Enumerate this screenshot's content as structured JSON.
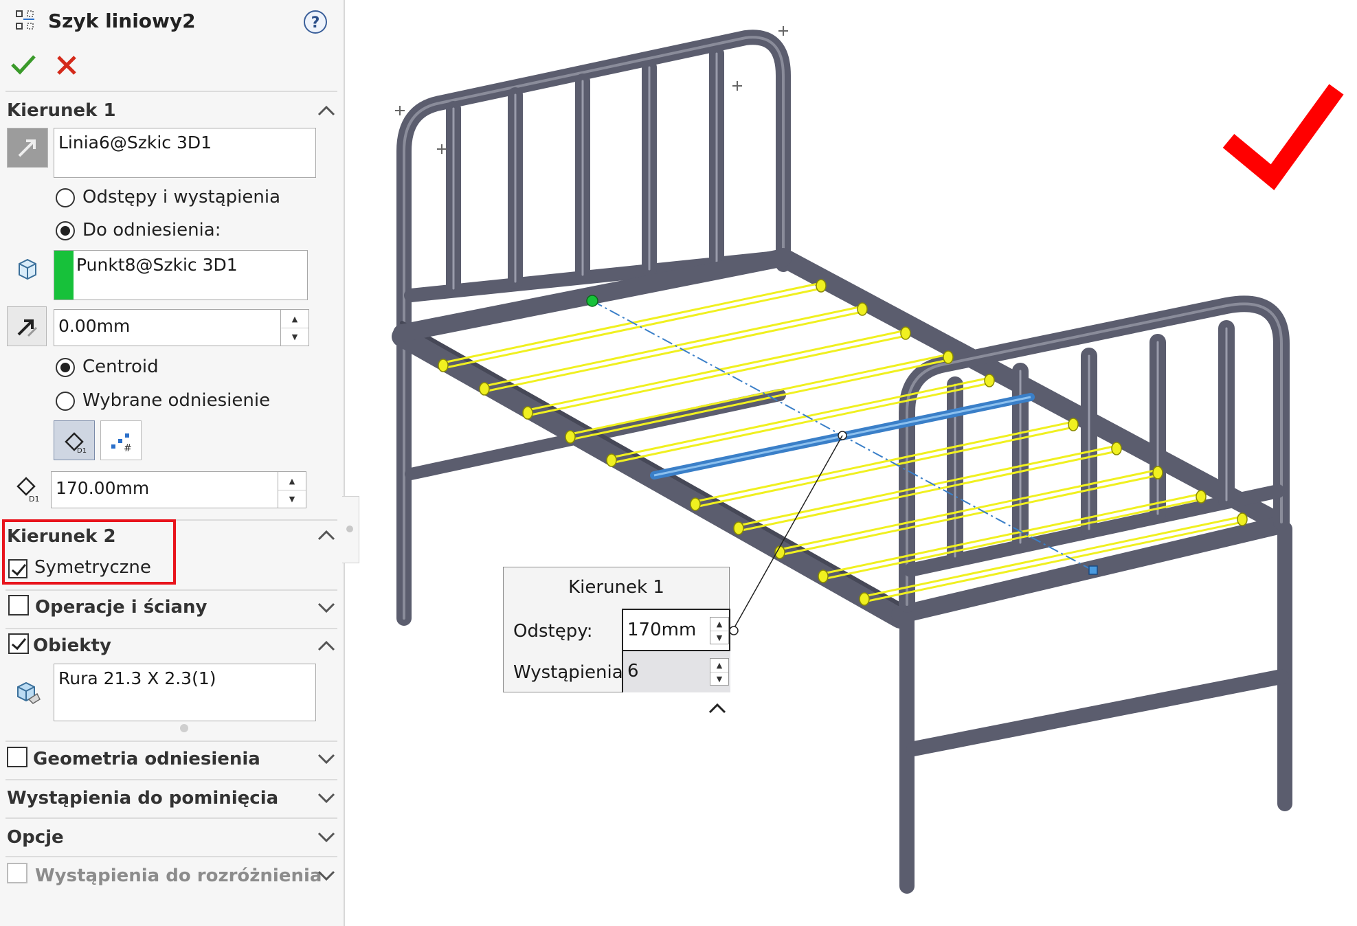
{
  "panel": {
    "title": "Szyk liniowy2",
    "help_icon": "help-icon",
    "ok_icon": "checkmark-icon",
    "cancel_icon": "close-icon",
    "direction1": {
      "header": "Kierunek 1",
      "direction_ref": "Linia6@Szkic 3D1",
      "option_spacing": "Odstępy i wystąpienia",
      "option_to_ref": "Do odniesienia:",
      "selected_option": "Do odniesienia:",
      "reference": "Punkt8@Szkic 3D1",
      "offset": "0.00mm",
      "centroid": "Centroid",
      "selected_ref": "Wybrane odniesienie",
      "ref_mode": "Centroid",
      "spacing": "170.00mm"
    },
    "direction2": {
      "header": "Kierunek 2",
      "symmetric_label": "Symetryczne",
      "symmetric_checked": true
    },
    "sections": {
      "features_faces": "Operacje i ściany",
      "bodies": "Obiekty",
      "bodies_value": "Rura 21.3 X 2.3(1)",
      "reference_geometry": "Geometria odniesienia",
      "instances_to_skip": "Wystąpienia do pominięcia",
      "options": "Opcje",
      "instances_to_vary": "Wystąpienia do rozróżnienia"
    },
    "colors": {
      "highlight_box": "#e8141c",
      "reference_marker": "#17c13a",
      "ok_color": "#3a9a2a",
      "cancel_color": "#d42a1a"
    }
  },
  "popup": {
    "title": "Kierunek 1",
    "spacing_label": "Odstępy:",
    "spacing_value": "170mm",
    "instances_label": "Wystąpienia:",
    "instances_value": "6"
  },
  "viewport": {
    "big_check_color": "#ff0000",
    "model_color": "#5b5d6e",
    "preview_color": "#f0f020",
    "selected_color": "#3a7fc8"
  }
}
